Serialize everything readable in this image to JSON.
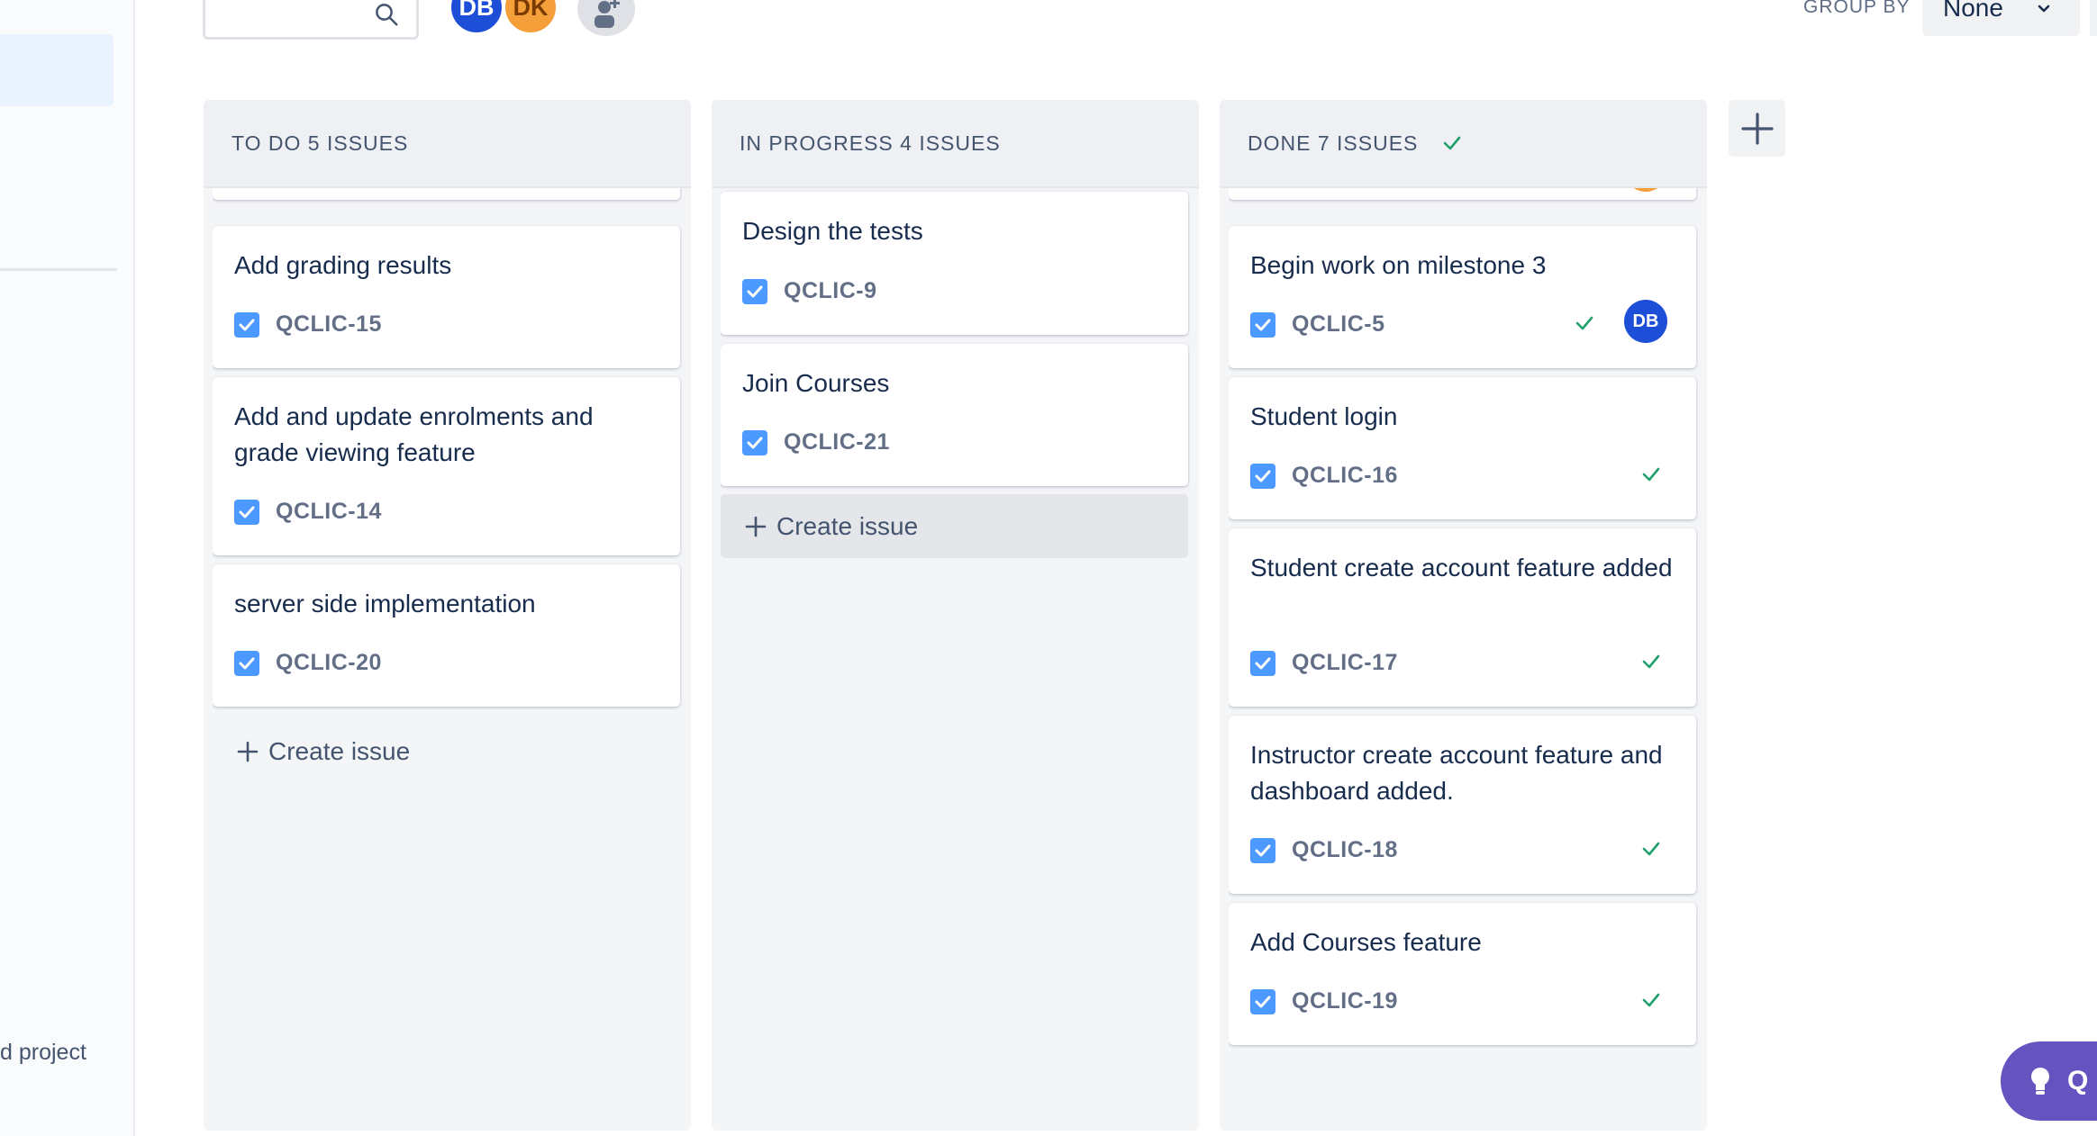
{
  "sidebar": {
    "project_text": "d project"
  },
  "toolbar": {
    "search_icon": "search-icon",
    "avatars": [
      {
        "initials": "DB",
        "color": "#1d4ed8"
      },
      {
        "initials": "DK",
        "color": "#f59f3a"
      }
    ],
    "add_people_icon": "add-person-icon",
    "group_by_label": "GROUP BY",
    "group_by_value": "None"
  },
  "colors": {
    "accent": "#1d4ed8",
    "done_green": "#22a06b",
    "checkbox_blue": "#4c9aff"
  },
  "columns": [
    {
      "header": "TO DO 5 ISSUES",
      "cards": [
        {
          "title": "Add grading results",
          "key": "QCLIC-15"
        },
        {
          "title": "Add and update enrolments and grade viewing feature",
          "key": "QCLIC-14"
        },
        {
          "title": "server side implementation",
          "key": "QCLIC-20"
        }
      ],
      "create_label": "Create issue"
    },
    {
      "header": "IN PROGRESS 4 ISSUES",
      "cards": [
        {
          "title": "Design the tests",
          "key": "QCLIC-9"
        },
        {
          "title": "Join Courses",
          "key": "QCLIC-21"
        }
      ],
      "create_label": "Create issue"
    },
    {
      "header": "DONE 7 ISSUES",
      "cards": [
        {
          "title": "Begin work on milestone 3",
          "key": "QCLIC-5",
          "assignee": "DB"
        },
        {
          "title": "Student login",
          "key": "QCLIC-16"
        },
        {
          "title": "Student create account feature added",
          "key": "QCLIC-17"
        },
        {
          "title": "Instructor create account feature and dashboard added.",
          "key": "QCLIC-18"
        },
        {
          "title": "Add Courses feature",
          "key": "QCLIC-19"
        }
      ]
    }
  ],
  "add_column_icon": "plus-icon",
  "feedback_button": {
    "label": "Q",
    "icon": "lightbulb-icon"
  }
}
